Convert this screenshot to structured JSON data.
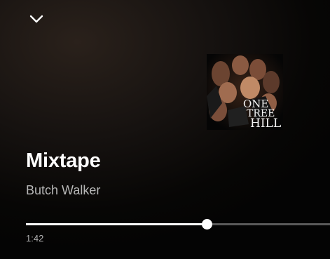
{
  "player": {
    "collapse_icon": "chevron-down-icon",
    "album_art_text": [
      "ONE",
      "TREE",
      "HILL"
    ],
    "title": "Mixtape",
    "artist": "Butch Walker",
    "elapsed": "1:42",
    "progress": 0.594,
    "colors": {
      "accent": "#ffffff",
      "track": "#5a5a5a",
      "artist_text": "#b8b8b8",
      "time_text": "#b0b0b0"
    }
  }
}
